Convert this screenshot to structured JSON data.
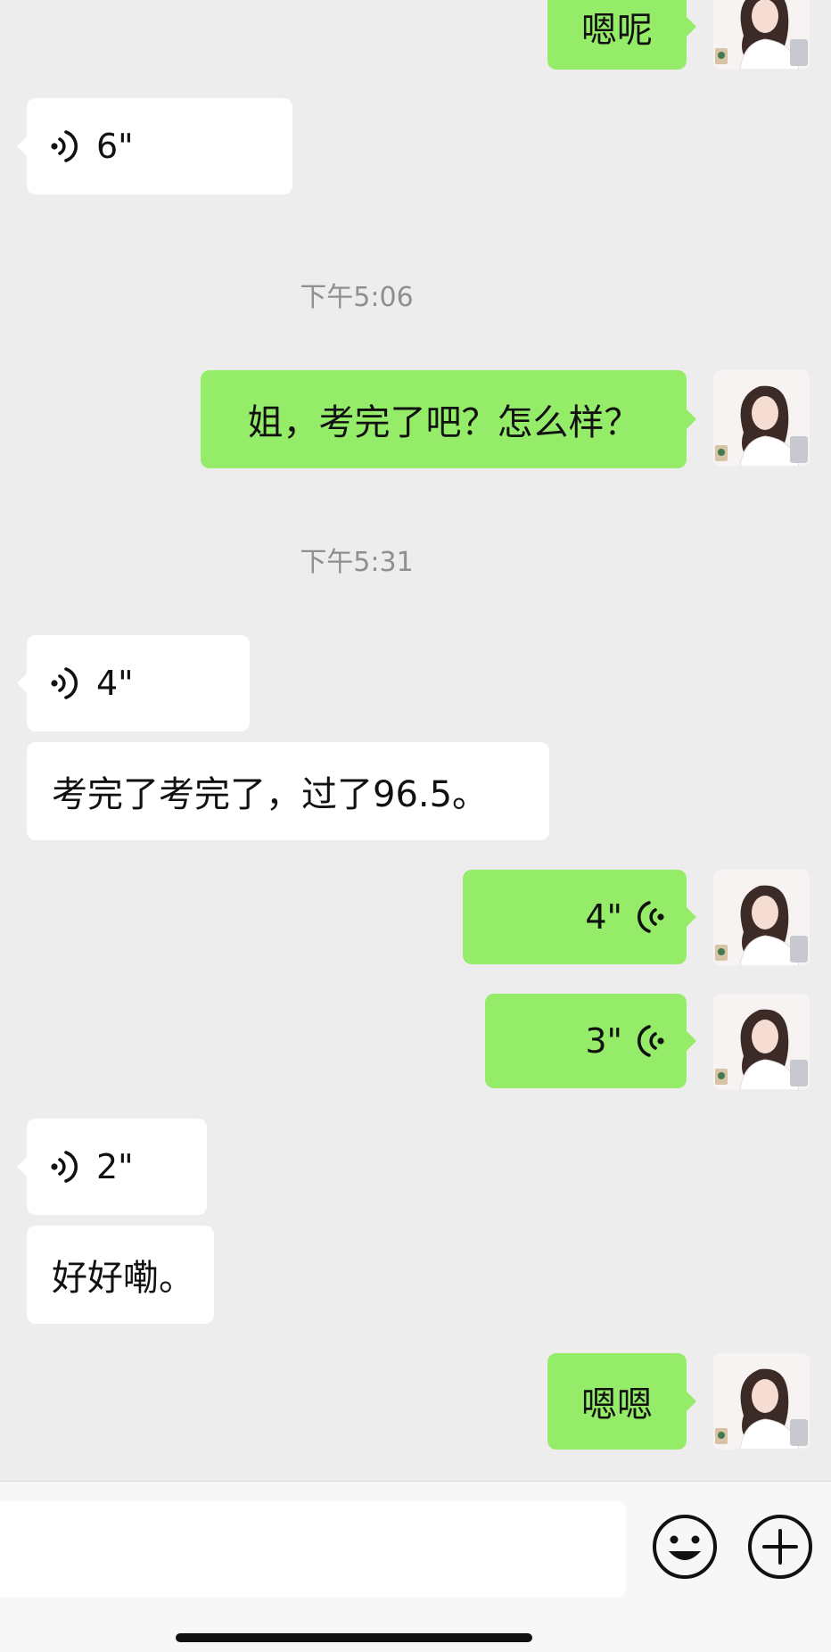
{
  "chat": {
    "messages": [
      {
        "side": "right",
        "kind": "text",
        "text": "嗯呢"
      },
      {
        "side": "left",
        "kind": "voice",
        "duration": "6\""
      },
      {
        "kind": "timestamp",
        "text": "下午5:06"
      },
      {
        "side": "right",
        "kind": "text",
        "text": "姐，考完了吧？怎么样？"
      },
      {
        "kind": "timestamp",
        "text": "下午5:31"
      },
      {
        "side": "left",
        "kind": "voice",
        "duration": "4\""
      },
      {
        "side": "left",
        "kind": "text",
        "text": "考完了考完了，过了96.5。"
      },
      {
        "side": "right",
        "kind": "voice",
        "duration": "4\""
      },
      {
        "side": "right",
        "kind": "voice",
        "duration": "3\""
      },
      {
        "side": "left",
        "kind": "voice",
        "duration": "2\""
      },
      {
        "side": "left",
        "kind": "text",
        "text": "好好嘞。"
      },
      {
        "side": "right",
        "kind": "text",
        "text": "嗯嗯"
      }
    ]
  },
  "input_bar": {
    "emoji_icon": "emoji-smile-icon",
    "plus_icon": "plus-circle-icon"
  },
  "colors": {
    "background": "#ededed",
    "sent_bubble": "#95ec69",
    "received_bubble": "#ffffff",
    "timestamp_text": "#8f8f8f"
  }
}
